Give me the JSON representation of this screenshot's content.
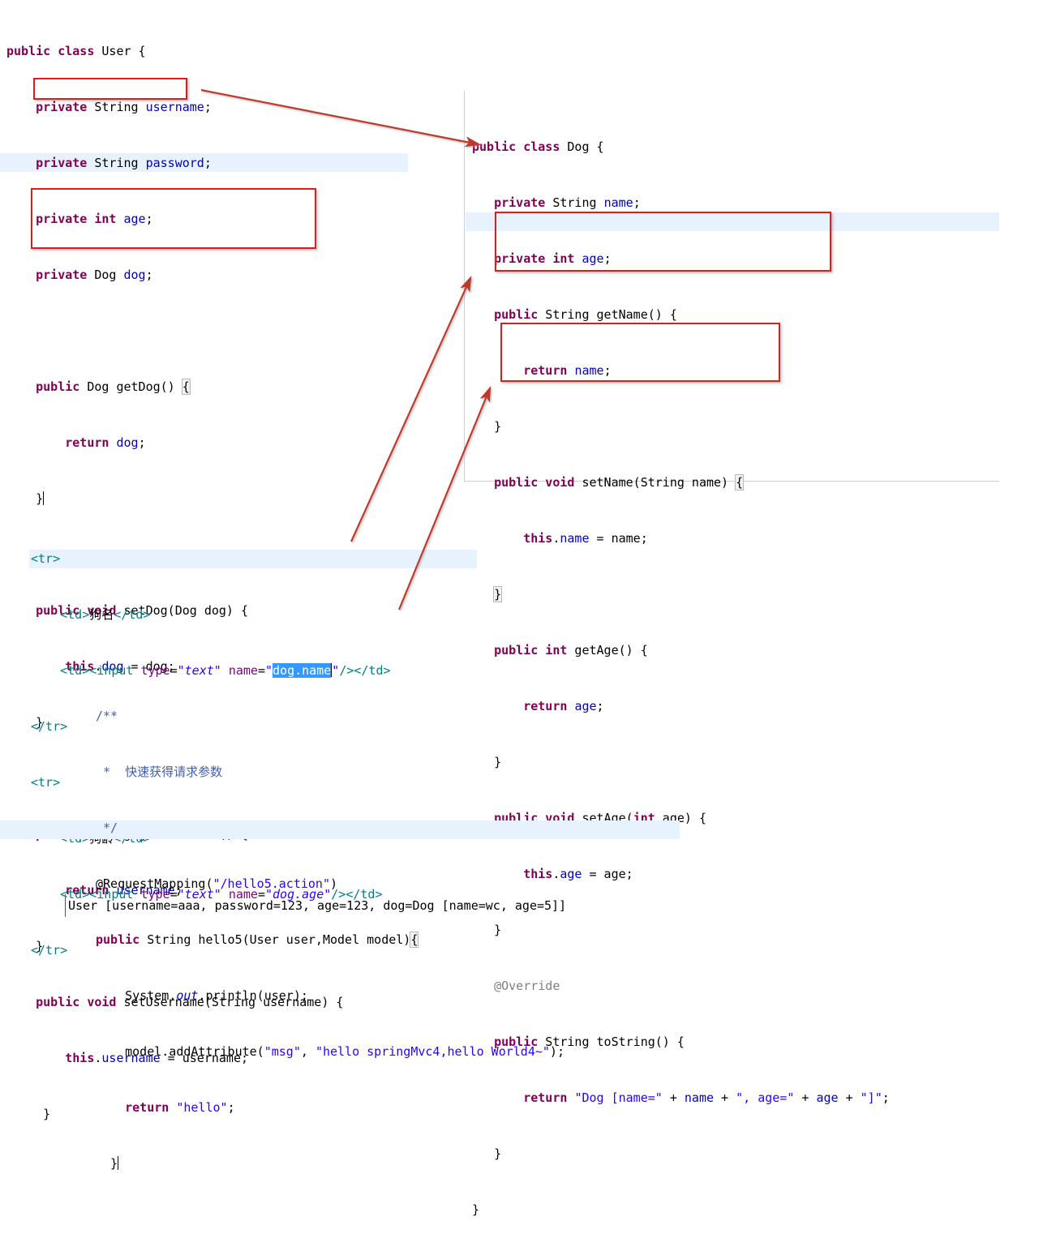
{
  "meta": {
    "accent_red": "#E01B1B",
    "keyword_color": "#7F0055",
    "field_color": "#0000C0",
    "string_color": "#2A00FF",
    "comment_color": "#3F5FBF",
    "annotation_color": "#808080",
    "html_tag_color": "#008080",
    "html_attr_color": "#7F007F",
    "selection_color": "#3399FF",
    "line_highlight_color": "#E8F2FE"
  },
  "user_class": {
    "l01": "public class User {",
    "l02": "    private String username;",
    "l03": "    private String password;",
    "l04": "    private int age;",
    "l05": "    private Dog dog;",
    "l06": "",
    "l07": "    public Dog getDog() {",
    "l08": "        return dog;",
    "l09": "    }",
    "l10": "",
    "l11": "    public void setDog(Dog dog) {",
    "l12": "        this.dog = dog;",
    "l13": "    }",
    "l14": "",
    "l15": "    public String getUsername() {",
    "l16": "        return username;",
    "l17": "    }",
    "l18": "    public void setUsername(String username) {",
    "l19": "        this.username = username;",
    "l20": "    }"
  },
  "dog_class": {
    "l01": "public class Dog {",
    "l02": "    private String name;",
    "l03": "    private int age;",
    "l04": "    public String getName() {",
    "l05": "        return name;",
    "l06": "    }",
    "l07": "    public void setName(String name) {",
    "l08": "        this.name = name;",
    "l09": "    }",
    "l10": "    public int getAge() {",
    "l11": "        return age;",
    "l12": "    }",
    "l13": "    public void setAge(int age) {",
    "l14": "        this.age = age;",
    "l15": "    }",
    "l16": "    @Override",
    "l17": "    public String toString() {",
    "l18": "        return \"Dog [name=\" + name + \", age=\" + age + \"]\";",
    "l19": "    }",
    "l20": "}"
  },
  "jsp_snippet": {
    "l01": "<tr>",
    "l02": "    <td>狗名</td>",
    "l03": "    <td><input type=\"text\" name=\"dog.name\"/></td>",
    "l04": "</tr>",
    "l05": "<tr>",
    "l06": "    <td>狗龄</td>",
    "l07": "    <td><input type=\"text\" name=\"dog.age\"/></td>",
    "l08": "</tr>",
    "selected_text": "dog.name",
    "td_label_name": "狗名",
    "td_label_age": "狗龄",
    "input_type_value": "text",
    "input_name_dog_name": "dog.name",
    "input_name_dog_age": "dog.age"
  },
  "controller_snippet": {
    "l01": "/**",
    "l02": " *  快速获得请求参数",
    "l03": " */",
    "l04": "@RequestMapping(\"/hello5.action\")",
    "l05": "public String hello5(User user,Model model){",
    "l06": "    System.out.println(user);",
    "l07": "    model.addAttribute(\"msg\", \"hello springMvc4,hello World4~\");",
    "l08": "    return \"hello\";",
    "l09": "}",
    "comment_text": "快速获得请求参数",
    "mapping_path": "/hello5.action",
    "method_name": "hello5",
    "model_key": "msg",
    "model_value": "hello springMvc4,hello World4~",
    "view_name": "hello"
  },
  "console": {
    "output": "User [username=aaa, password=123, age=123, dog=Dog [name=wc, age=5]]"
  },
  "annotations": {
    "box_1_label": "private Dog dog; field highlight",
    "box_2_label": "setDog method highlight",
    "box_3_label": "setName method highlight",
    "box_4_label": "setAge method highlight",
    "arrow_1_label": "dog field to Dog class arrow",
    "arrow_2_label": "dog.name input to setName arrow",
    "arrow_3_label": "dog.age input to setAge arrow"
  }
}
